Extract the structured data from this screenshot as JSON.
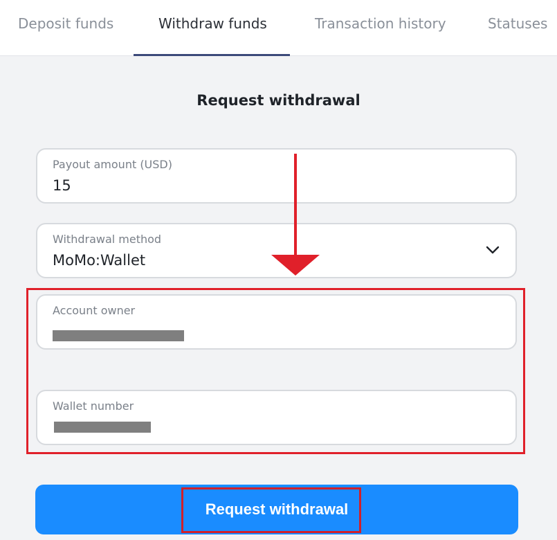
{
  "tabs": [
    {
      "label": "Deposit funds",
      "active": false
    },
    {
      "label": "Withdraw funds",
      "active": true
    },
    {
      "label": "Transaction history",
      "active": false
    },
    {
      "label": "Statuses",
      "active": false
    }
  ],
  "form": {
    "title": "Request withdrawal",
    "payout": {
      "label": "Payout amount (USD)",
      "value": "15"
    },
    "method": {
      "label": "Withdrawal method",
      "value": "MoMo:Wallet",
      "icon": "chevron-down-icon"
    },
    "owner": {
      "label": "Account owner"
    },
    "wallet": {
      "label": "Wallet number"
    },
    "submit_label": "Request withdrawal"
  },
  "colors": {
    "accent": "#1a8cff",
    "highlight": "#e0202a",
    "arrow": "#e0202a"
  }
}
